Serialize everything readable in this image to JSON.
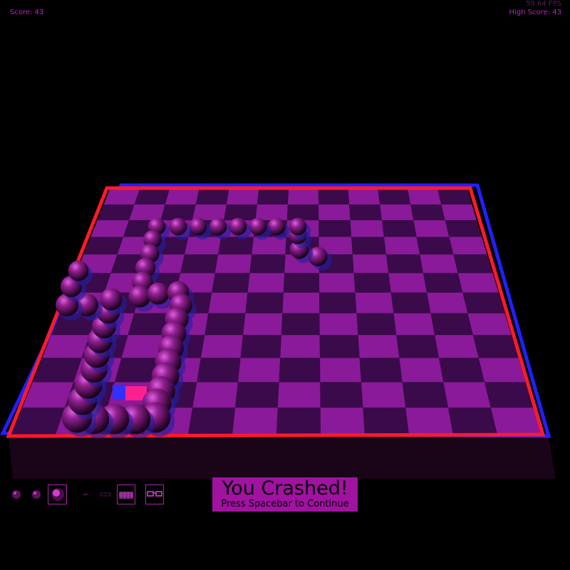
{
  "hud": {
    "score": "Score: 43",
    "fps": "59.64 FPS",
    "high_score": "High Score: 43"
  },
  "message": {
    "title": "You Crashed!",
    "subtitle": "Press Spacebar to Continue"
  },
  "toolbar": {
    "buttons": [
      "sphere-small-icon",
      "sphere-medium-icon",
      "sphere-large-icon",
      "dot-small-icon",
      "dash-icon",
      "texture-icon",
      "3d-glasses-icon"
    ]
  },
  "colors": {
    "accent": "#c020c0",
    "board_light": "#8a1a9a",
    "board_dark": "#3a0a4a",
    "red_channel": "#ff1a2a",
    "blue_channel": "#2020ff"
  },
  "board": {
    "rows": 12,
    "cols": 12,
    "snake_length": 43
  }
}
